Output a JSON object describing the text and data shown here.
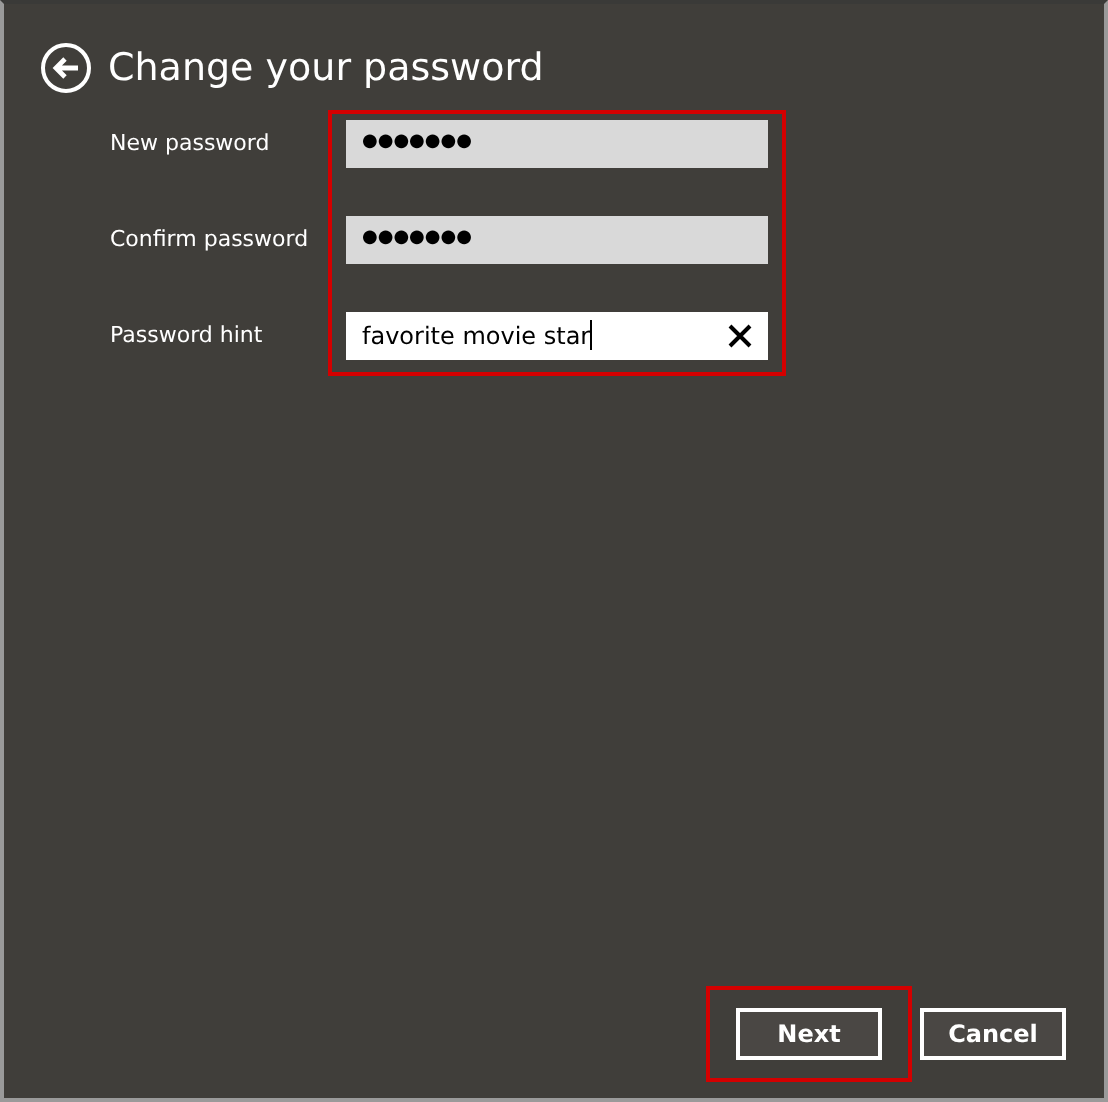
{
  "title": "Change your password",
  "fields_highlighted": true,
  "fields": [
    {
      "label": "New password",
      "value": "●●●●●●●",
      "kind": "password",
      "focused": false
    },
    {
      "label": "Confirm password",
      "value": "●●●●●●●",
      "kind": "password",
      "focused": false
    },
    {
      "label": "Password hint",
      "value": "favorite movie star",
      "kind": "text",
      "focused": true
    }
  ],
  "buttons": [
    {
      "label": "Next",
      "highlighted": true
    },
    {
      "label": "Cancel",
      "highlighted": false
    }
  ]
}
